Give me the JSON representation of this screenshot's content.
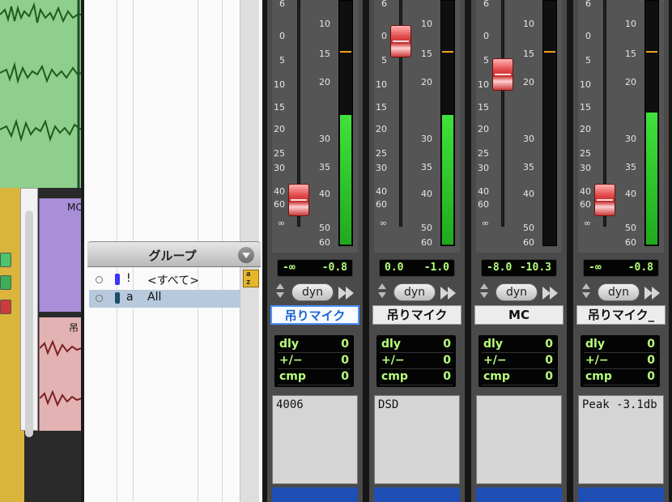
{
  "edit_window": {
    "clip_label_1": "MC",
    "clip_label_2": "吊"
  },
  "groups_panel": {
    "title": "グループ",
    "sort_button": "a z",
    "rows": [
      {
        "id": "!",
        "name": "<すべて>",
        "color": "#3b32ff",
        "selected": false
      },
      {
        "id": "a",
        "name": "All",
        "color": "#1d4d6b",
        "selected": true
      }
    ]
  },
  "mixer": {
    "scale_left": [
      "6",
      "0",
      "5",
      "10",
      "15",
      "20",
      "25",
      "30",
      "40",
      "60",
      "∞"
    ],
    "scale_right": [
      "10",
      "15",
      "20",
      "30",
      "35",
      "40",
      "50",
      "60"
    ],
    "dyn_label": "dyn",
    "delay_labels": [
      "dly",
      "+/−",
      "cmp"
    ],
    "channels": [
      {
        "name": "吊りマイク",
        "active": true,
        "volume": "-∞",
        "peak": "-0.8",
        "fader_pos": 0.88,
        "meter_level": 0.53,
        "delay": [
          "0",
          "0",
          "0"
        ],
        "comment": "4006"
      },
      {
        "name": "吊りマイク",
        "active": false,
        "volume": "0.0",
        "peak": "-1.0",
        "fader_pos": 0.12,
        "meter_level": 0.53,
        "delay": [
          "0",
          "0",
          "0"
        ],
        "comment": "DSD"
      },
      {
        "name": "MC",
        "active": false,
        "volume": "-8.0",
        "peak": "-10.3",
        "fader_pos": 0.28,
        "meter_level": 0.0,
        "delay": [
          "0",
          "0",
          "0"
        ],
        "comment": ""
      },
      {
        "name": "吊りマイク_",
        "active": false,
        "volume": "-∞",
        "peak": "-0.8",
        "fader_pos": 0.88,
        "meter_level": 0.54,
        "delay": [
          "0",
          "0",
          "0"
        ],
        "comment": "Peak -3.1db"
      }
    ]
  }
}
